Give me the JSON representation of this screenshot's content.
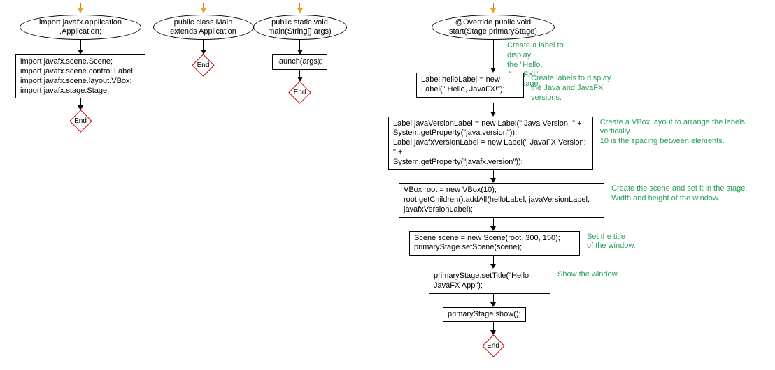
{
  "col1": {
    "ellipse": "import javafx.application\n.Application;",
    "box": "import javafx.scene.Scene;\nimport javafx.scene.control.Label;\nimport javafx.scene.layout.VBox;\nimport javafx.stage.Stage;",
    "end": "End"
  },
  "col2": {
    "ellipse": "public class Main\nextends Application",
    "end": "End"
  },
  "col3": {
    "ellipse": "public static void\nmain(String[] args)",
    "box": "launch(args);",
    "end": "End"
  },
  "col4": {
    "ellipse": "@Override public void\nstart(Stage primaryStage)",
    "annot1": "Create a label to display\nthe \"Hello, JavaFX!\"\nmessage.",
    "box1": "Label helloLabel = new\nLabel(\" Hello, JavaFX!\");",
    "annot2": "Create labels to display\nthe Java and JavaFX\nversions.",
    "box2": "Label javaVersionLabel = new Label(\" Java Version: \" +\nSystem.getProperty(\"java.version\"));\nLabel javafxVersionLabel = new Label(\" JavaFX Version: \" +\nSystem.getProperty(\"javafx.version\"));",
    "annot3": "Create a VBox layout to arrange the labels vertically.\n10 is the spacing between elements.",
    "box3": "VBox root = new VBox(10);\nroot.getChildren().addAll(helloLabel, javaVersionLabel,\njavafxVersionLabel);",
    "annot4": "Create the scene and set it in the stage.\nWidth and height of the window.",
    "box4": "Scene scene = new Scene(root, 300, 150);\nprimaryStage.setScene(scene);",
    "annot5": "Set the title\nof the window.",
    "box5": "primaryStage.setTitle(\"Hello\nJavaFX App\");",
    "annot6": "Show the window.",
    "box6": "primaryStage.show();",
    "end": "End"
  }
}
